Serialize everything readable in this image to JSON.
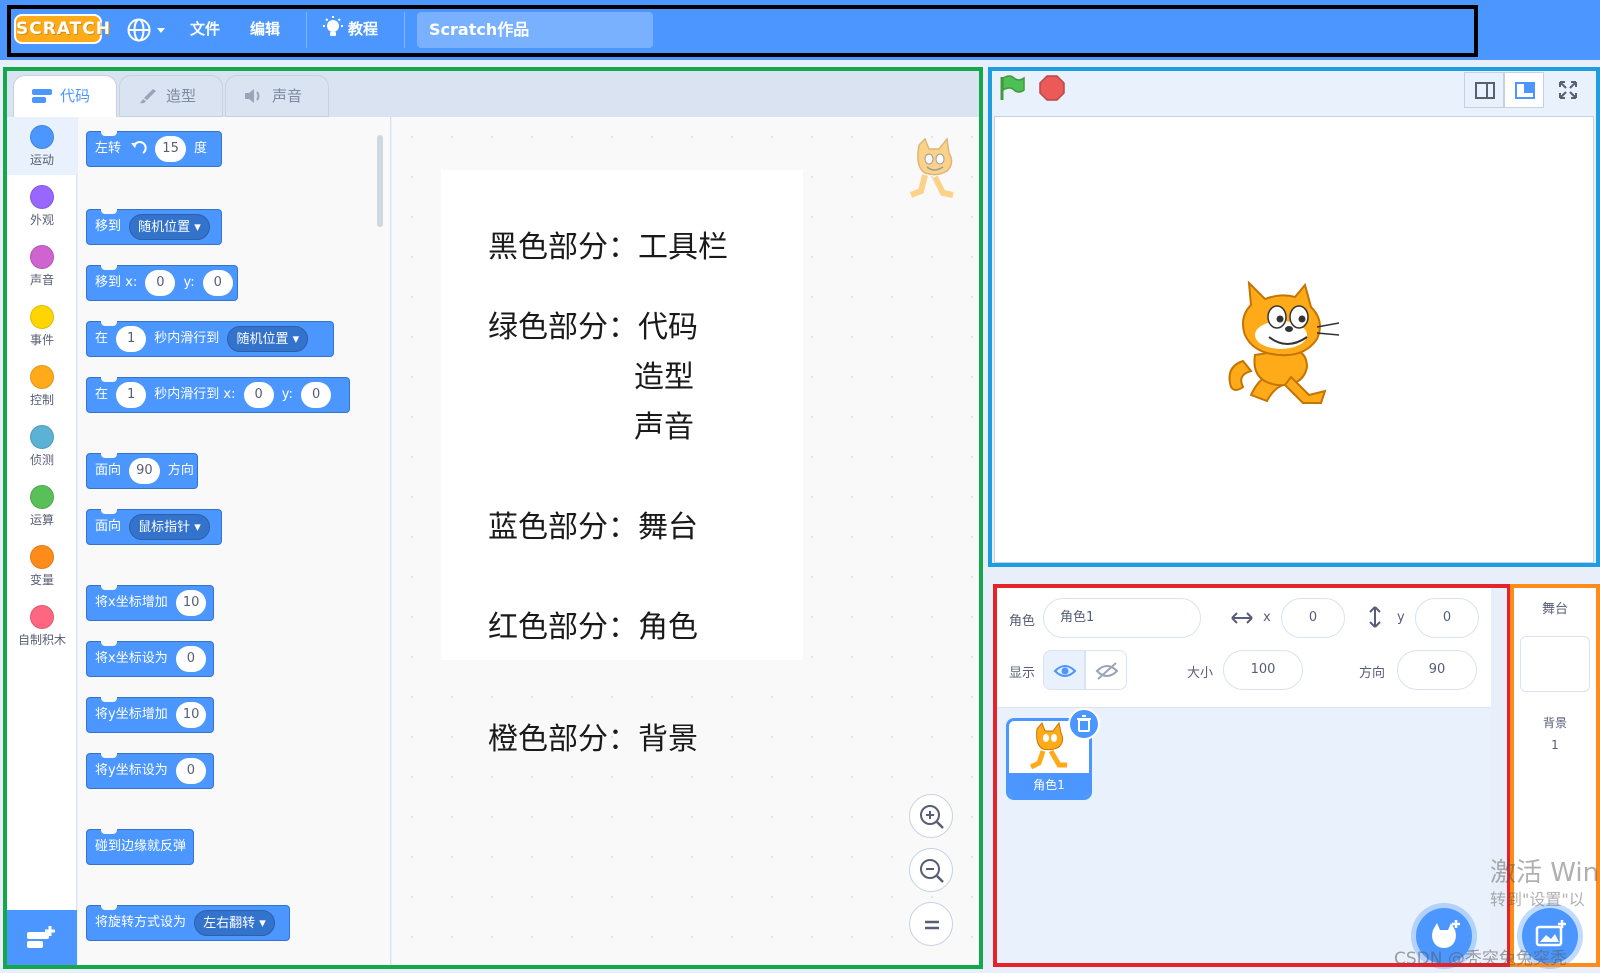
{
  "menubar": {
    "logo": "SCRATCH",
    "file": "文件",
    "edit": "编辑",
    "tutorials": "教程",
    "project_title": "Scratch作品"
  },
  "tabs": [
    {
      "label": "代码"
    },
    {
      "label": "造型"
    },
    {
      "label": "声音"
    }
  ],
  "categories": [
    {
      "label": "运动",
      "color": "#4c97ff"
    },
    {
      "label": "外观",
      "color": "#9966ff"
    },
    {
      "label": "声音",
      "color": "#cf63cf"
    },
    {
      "label": "事件",
      "color": "#ffd500"
    },
    {
      "label": "控制",
      "color": "#ffab19"
    },
    {
      "label": "侦测",
      "color": "#5cb1d6"
    },
    {
      "label": "运算",
      "color": "#59c059"
    },
    {
      "label": "变量",
      "color": "#ff8c1a"
    },
    {
      "label": "自制积木",
      "color": "#ff6680"
    }
  ],
  "blocks": {
    "turn_left": {
      "label": "左转",
      "value": "15",
      "unit": "度"
    },
    "goto": {
      "label": "移到",
      "option": "随机位置"
    },
    "goto_xy": {
      "label": "移到 x:",
      "x": "0",
      "ylabel": "y:",
      "y": "0"
    },
    "glide_to": {
      "label": "在",
      "secs": "1",
      "mid": "秒内滑行到",
      "option": "随机位置"
    },
    "glide_xy": {
      "label": "在",
      "secs": "1",
      "mid": "秒内滑行到 x:",
      "x": "0",
      "ylabel": "y:",
      "y": "0"
    },
    "point_dir": {
      "label": "面向",
      "value": "90",
      "unit": "方向"
    },
    "point_towards": {
      "label": "面向",
      "option": "鼠标指针"
    },
    "change_x": {
      "label": "将x坐标增加",
      "value": "10"
    },
    "set_x": {
      "label": "将x坐标设为",
      "value": "0"
    },
    "change_y": {
      "label": "将y坐标增加",
      "value": "10"
    },
    "set_y": {
      "label": "将y坐标设为",
      "value": "0"
    },
    "bounce": {
      "label": "碰到边缘就反弹"
    },
    "rotation_style": {
      "label": "将旋转方式设为",
      "option": "左右翻转"
    }
  },
  "notes": {
    "black": "黑色部分：工具栏",
    "green": "绿色部分：代码",
    "green2": "造型",
    "green3": "声音",
    "blue": "蓝色部分：舞台",
    "red": "红色部分：角色",
    "orange": "橙色部分：背景"
  },
  "sprite_info": {
    "sprite_label": "角色",
    "sprite_name": "角色1",
    "x_label": "x",
    "x_value": "0",
    "y_label": "y",
    "y_value": "0",
    "show_label": "显示",
    "size_label": "大小",
    "size_value": "100",
    "direction_label": "方向",
    "direction_value": "90"
  },
  "sprites": [
    {
      "name": "角色1"
    }
  ],
  "stage_pane": {
    "title": "舞台",
    "backdrops_label": "背景",
    "backdrops_count": "1"
  },
  "overlay": {
    "watermark_line1": "激活 Win",
    "watermark_line2": "转到\"设置\"以",
    "credit": "CSDN @秃突兔兔突秃"
  },
  "colors": {
    "menubar": "#4c97ff",
    "frame_black": "#000000",
    "frame_green": "#13a94a",
    "frame_blue": "#1f9de0",
    "frame_red": "#e5232b",
    "frame_orange": "#ff8c1a"
  }
}
